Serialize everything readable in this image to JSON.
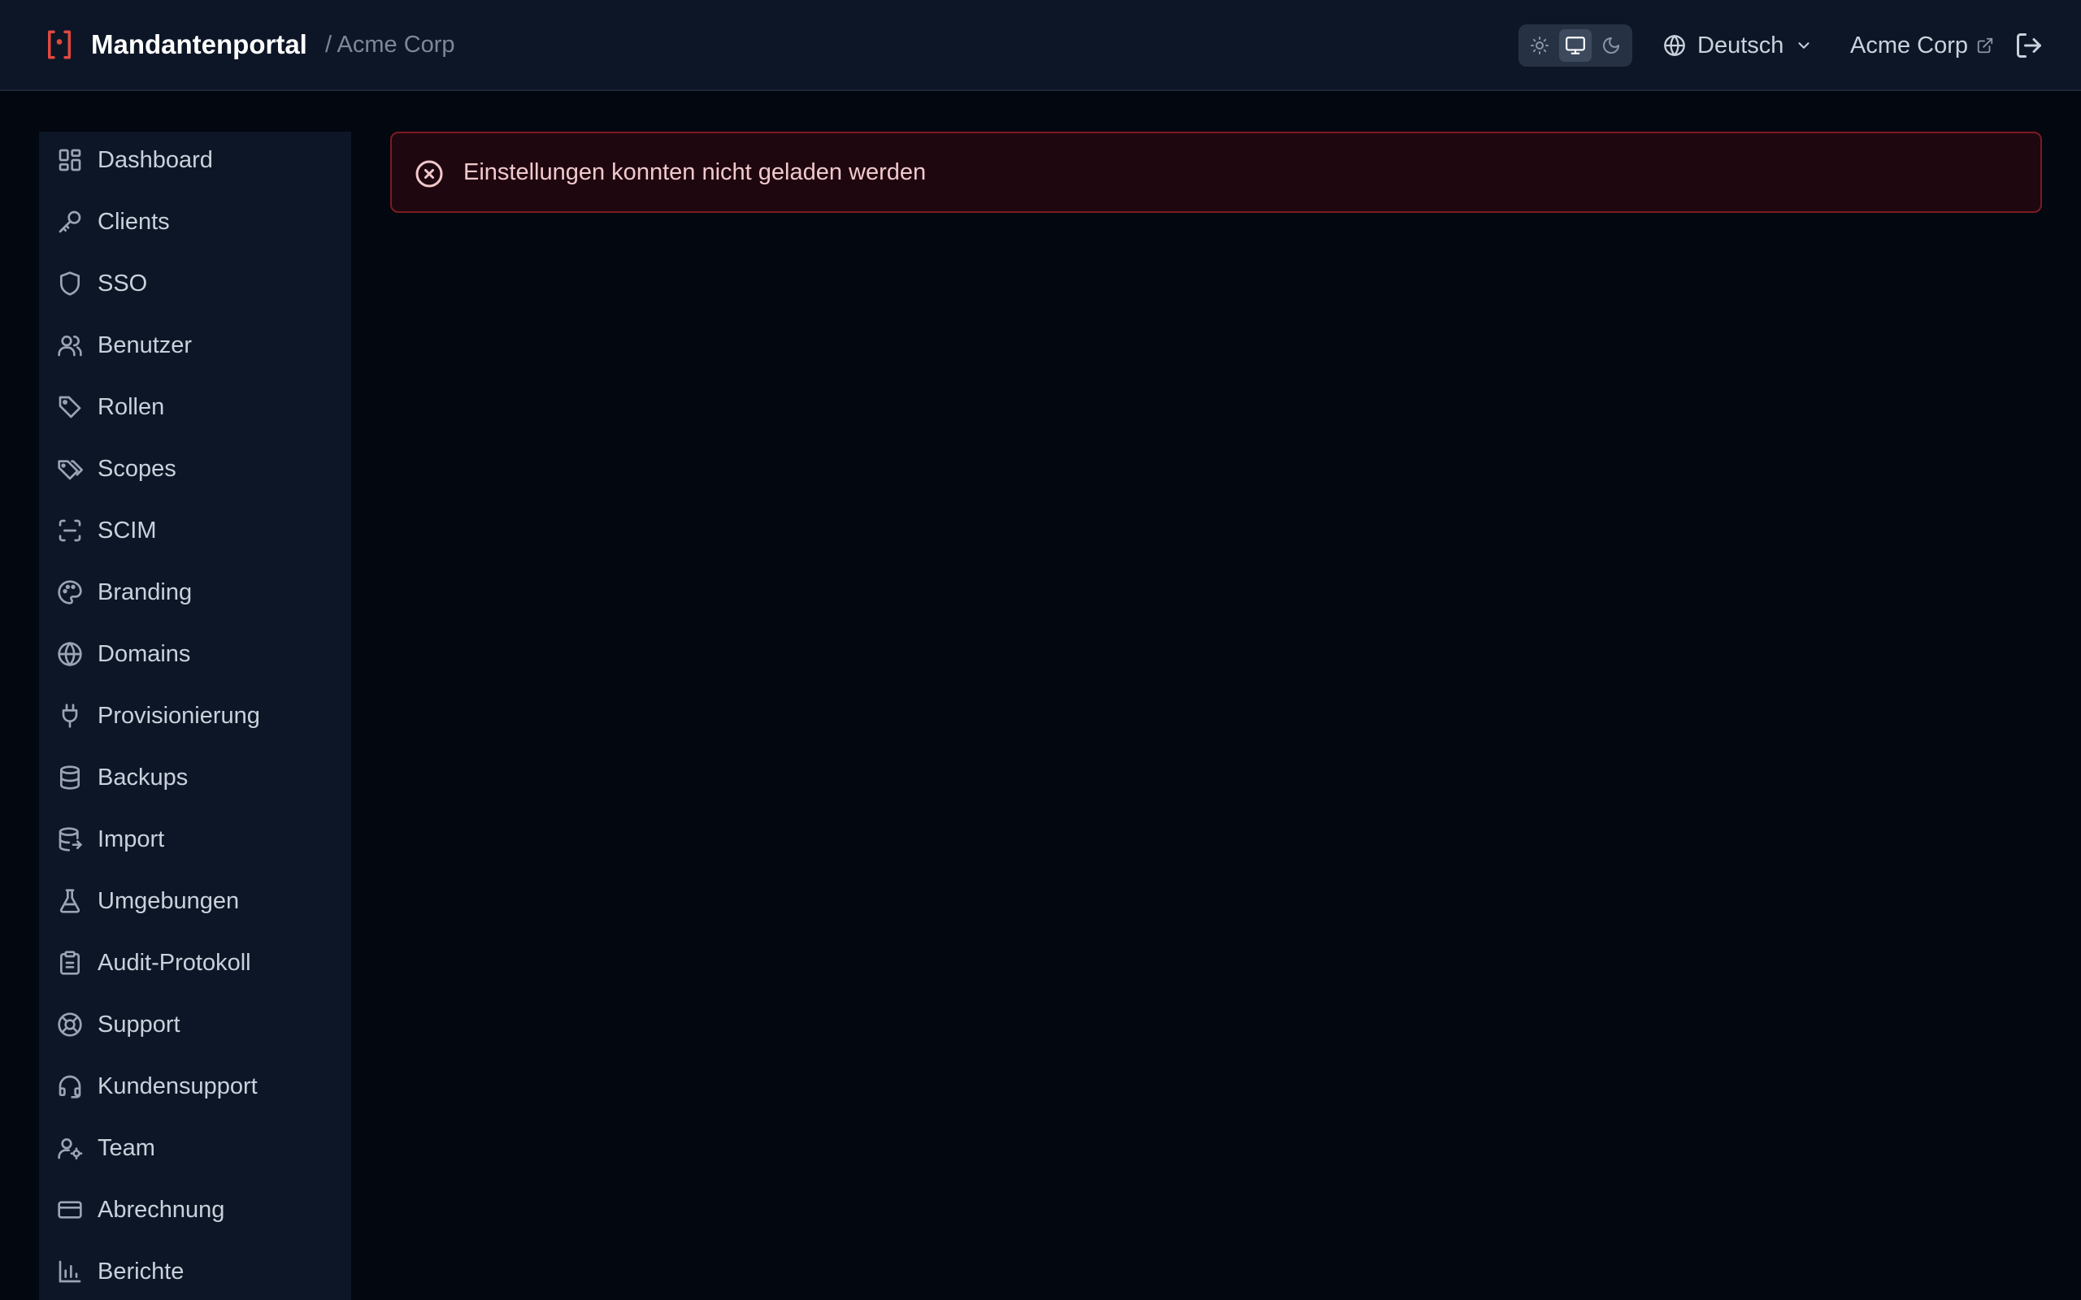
{
  "header": {
    "title": "Mandantenportal",
    "breadcrumb": "/ Acme Corp",
    "logo_icon": "bracket-logo-icon",
    "theme_options": [
      {
        "name": "light",
        "icon": "sun-icon",
        "active": false
      },
      {
        "name": "system",
        "icon": "monitor-icon",
        "active": true
      },
      {
        "name": "dark",
        "icon": "moon-icon",
        "active": false
      }
    ],
    "language": "Deutsch",
    "organization": "Acme Corp"
  },
  "sidebar": {
    "items": [
      {
        "label": "Dashboard",
        "icon": "dashboard-icon"
      },
      {
        "label": "Clients",
        "icon": "key-icon"
      },
      {
        "label": "SSO",
        "icon": "shield-icon"
      },
      {
        "label": "Benutzer",
        "icon": "users-icon"
      },
      {
        "label": "Rollen",
        "icon": "tag-icon"
      },
      {
        "label": "Scopes",
        "icon": "tags-icon"
      },
      {
        "label": "SCIM",
        "icon": "scan-icon"
      },
      {
        "label": "Branding",
        "icon": "palette-icon"
      },
      {
        "label": "Domains",
        "icon": "globe-icon"
      },
      {
        "label": "Provisionierung",
        "icon": "plug-icon"
      },
      {
        "label": "Backups",
        "icon": "database-icon"
      },
      {
        "label": "Import",
        "icon": "database-import-icon"
      },
      {
        "label": "Umgebungen",
        "icon": "flask-icon"
      },
      {
        "label": "Audit-Protokoll",
        "icon": "clipboard-icon"
      },
      {
        "label": "Support",
        "icon": "lifebuoy-icon"
      },
      {
        "label": "Kundensupport",
        "icon": "headset-icon"
      },
      {
        "label": "Team",
        "icon": "user-cog-icon"
      },
      {
        "label": "Abrechnung",
        "icon": "credit-card-icon"
      },
      {
        "label": "Berichte",
        "icon": "bar-chart-icon"
      }
    ]
  },
  "alert": {
    "message": "Einstellungen konnten nicht geladen werden",
    "icon": "x-circle-icon",
    "color": "#e05563"
  },
  "colors": {
    "background": "#03070f",
    "panel": "#0d1626",
    "accent_logo": "#e0483e"
  }
}
